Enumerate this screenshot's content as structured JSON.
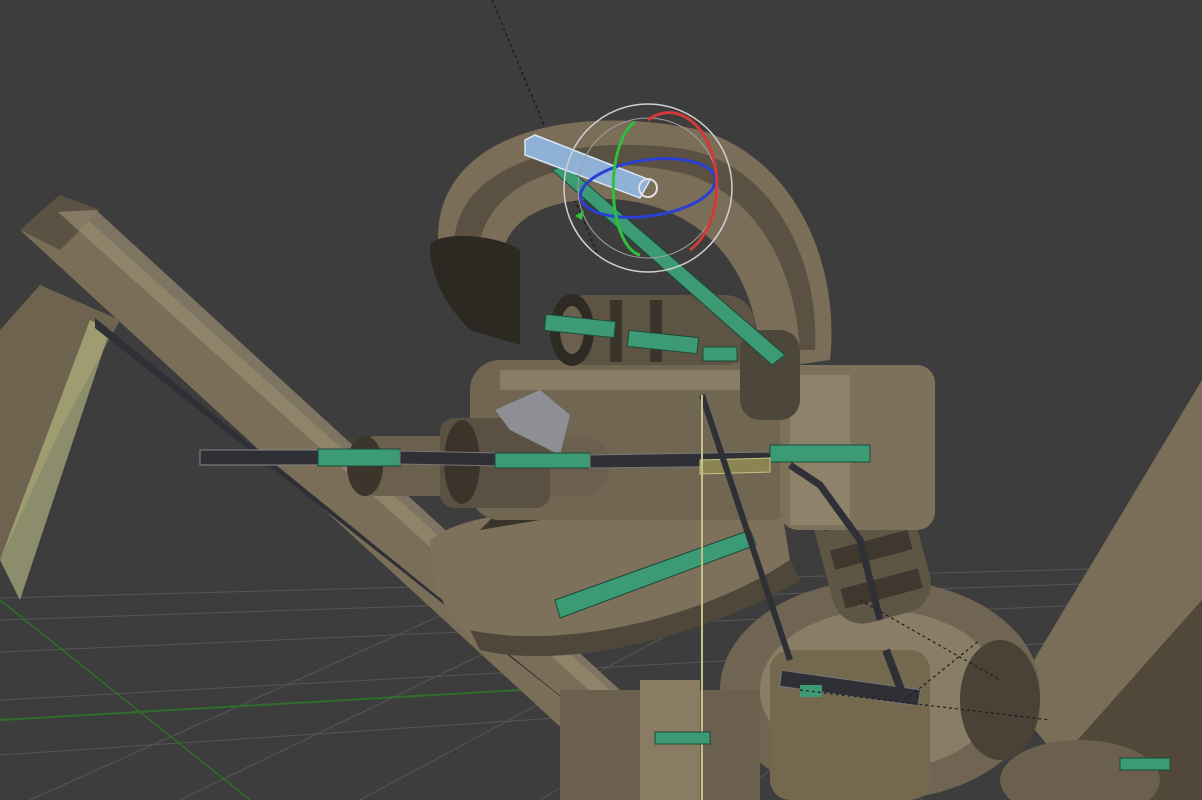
{
  "viewport": {
    "background_color": "#3d3d3d",
    "grid_color": "#5a5a5a",
    "x_axis_color": "#8a3b3b",
    "y_axis_color": "#4f7f2f",
    "mesh_color": "#7d715c",
    "mesh_shadow_color": "#4f473a",
    "mesh_highlight_color": "#a79a80",
    "bone_selected_color": "#8fb1d6",
    "bone_posed_color": "#3c9a74",
    "bone_dark_color": "#2f3036",
    "bone_yellow_color": "#c2c38a",
    "gizmo": {
      "outer_ring_color": "#cfcfcf",
      "x_rotate_color": "#d23a3a",
      "y_rotate_color": "#2fbf3a",
      "z_rotate_color": "#2a3fd3"
    },
    "icons": [
      "rotate-gizmo-icon",
      "bone-icon",
      "ik-constraint-line-icon"
    ]
  }
}
